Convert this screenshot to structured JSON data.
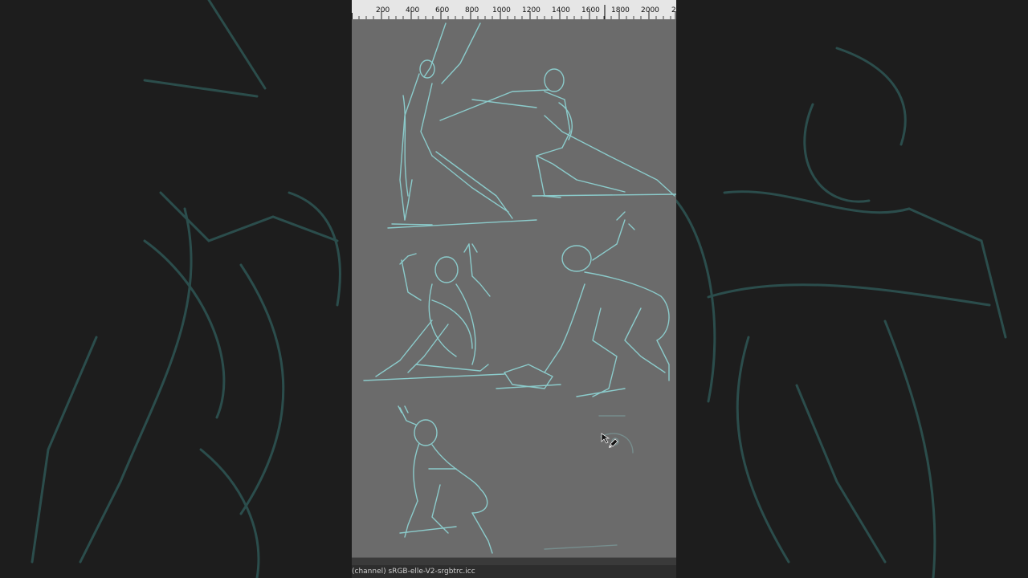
{
  "ruler": {
    "labels": [
      "200",
      "400",
      "600",
      "800",
      "1000",
      "1200",
      "1400",
      "1600",
      "1800",
      "2000",
      "2"
    ]
  },
  "statusbar": {
    "text": "(channel) sRGB-elle-V2-srgbtrc.icc"
  },
  "colors": {
    "canvas": "#6b6b6b",
    "sketch_stroke": "#8fd6d6",
    "background_dark": "#1d1d1d"
  },
  "icons": {
    "cursor": "brush-cursor-icon"
  }
}
